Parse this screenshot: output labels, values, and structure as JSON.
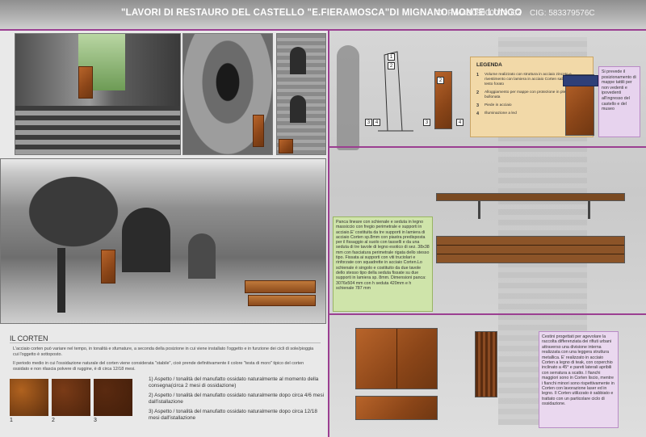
{
  "header": {
    "title": "\"LAVORI DI RESTAURO DEL CASTELLO \"E.FIERAMOSCA\"DI MIGNANO MONTE LUNGO",
    "cup": "CUP I44B08000010002",
    "cig": "CIG: 583379576C"
  },
  "legend": {
    "title": "LEGENDA",
    "items": [
      {
        "num": "1",
        "text": "Volume realizzato con struttura in acciaio zincato e rivestimento con lamiera in acciaio Corten sabbiato con testo forato"
      },
      {
        "num": "2",
        "text": "Alloggiamento per mappe con protezione in plexiglas bullonata"
      },
      {
        "num": "3",
        "text": "Piede in acciaio"
      },
      {
        "num": "4",
        "text": "Illuminazione a led"
      }
    ]
  },
  "side_notes": {
    "maps_note": "Si prevede il posizionamento di mappe tattili per non vedenti e ipovedenti all'ingresso del castello e del museo",
    "bench_note": "Panca lineare con schienale e seduta in legno massiccio con fregio perimetrale e supporti in acciaio.E' costituita da tre supporti in lamiera di acciaio Corten sp.8mm con piastra predisposta per il fissaggio al suolo con tasselli e da una seduta di tre tavole di legno esotico di sez. 38x38 mm con fasciatura perimetrale rigata dello stesso tipo. Fissata ai supporti con viti truciolari e rinforzate con squadrette in acciaio Corten.Lo schienale è singolo e costituito da due tavole dello stesso tipo della seduta fissate su due supporti in lamiera sp. 8mm. Dimensioni panca: 3076x504 mm con h seduta 420mm e h schienale 787 mm",
    "bin_note": "Cestini progettati per agevolare la raccolta differenziata dei rifiuti urbani attraverso una divisione interna realizzata con una leggera struttura metallica. E' realizzato in acciaio Corten a legno di teak, con coperchio inclinato a 45° e pareti laterali apribili con serratura a scatto. I fianchi maggiori sono in Corten liscio, mentre i fianchi minori sono rispettivamente in Corten con lavorazione laser ed in legno. Il Corten utilizzato è sabbiato e trattato con un particolare ciclo di ossidazione."
  },
  "corten": {
    "title": "IL CORTEN",
    "p1": "L'acciaio corten può variare nel tempo, in tonalità e sfumature, a seconda della posizione in cui viene installato l'oggetto e in funzione dei cicli di sole/pioggia cui l'oggetto è sottoposto.",
    "p2": "Il periodo medio in cui l'ossidazione naturale del corten viene considerata \"stabile\", cioè prende definitivamente il colore \"testa di moro\" tipico del corten ossidato e non rilascia polvere di ruggine, è di circa 12/18 mesi.",
    "swatches": [
      {
        "label": "1",
        "color": "#b0621f"
      },
      {
        "label": "2",
        "color": "#7a3b17"
      },
      {
        "label": "3",
        "color": "#5a2a10"
      }
    ],
    "oxidation": [
      "1) Aspetto / tonalità del manufatto ossidato naturalmente al momento della consegna(circa 2 mesi di ossidazione)",
      "2) Aspetto / tonalità del manufatto ossidato naturalmente dopo circa 4/6 mesi dall'istallazione",
      "3) Aspetto / tonalità del manufatto ossidato naturalmente dopo circa 12/18 mesi dall'istallazione"
    ]
  },
  "callouts": {
    "front_view_nums": [
      "1",
      "2",
      "3",
      "4"
    ],
    "side_view_nums": [
      "2",
      "3",
      "4"
    ]
  }
}
